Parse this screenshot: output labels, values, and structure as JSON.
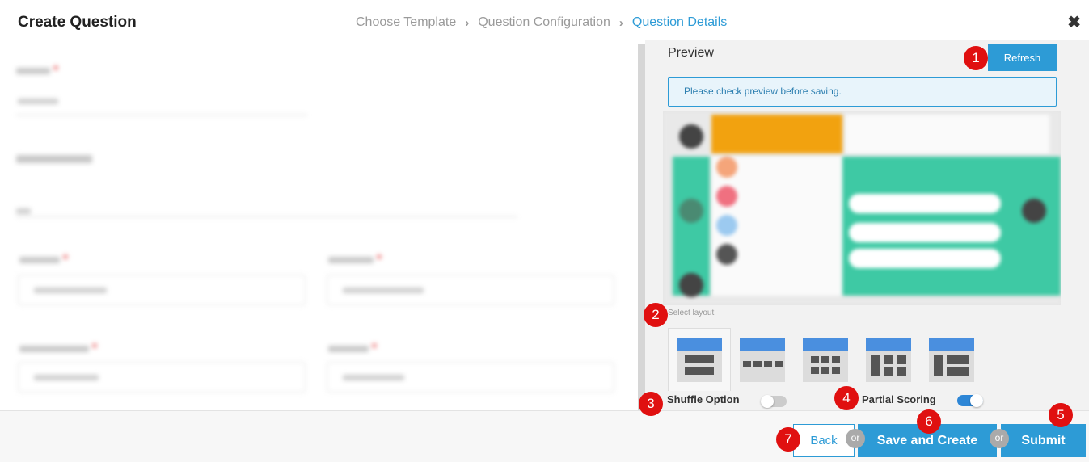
{
  "header": {
    "title": "Create Question",
    "breadcrumbs": [
      "Choose Template",
      "Question Configuration",
      "Question Details"
    ],
    "close_icon": "close-icon"
  },
  "preview": {
    "title": "Preview",
    "refresh_label": "Refresh",
    "notice": "Please check preview before saving.",
    "select_layout_label": "Select layout",
    "layout_icons": [
      "layout-single-column-icon",
      "layout-four-in-row-icon",
      "layout-grid-icon",
      "layout-mixed-grid-icon",
      "layout-list-icon"
    ],
    "shuffle_label": "Shuffle Option",
    "shuffle_on": false,
    "partial_label": "Partial Scoring",
    "partial_on": true
  },
  "footer": {
    "back_label": "Back",
    "or_label": "or",
    "save_create_label": "Save and Create",
    "submit_label": "Submit"
  },
  "markers": [
    "1",
    "2",
    "3",
    "4",
    "5",
    "6",
    "7"
  ],
  "colors": {
    "accent": "#2d9bd6",
    "marker": "#e01010",
    "toggle_on": "#2d86d6"
  }
}
